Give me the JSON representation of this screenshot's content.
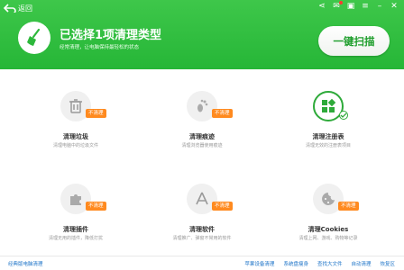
{
  "header": {
    "back_label": "返回",
    "title": "已选择1项清理类型",
    "subtitle": "经常清理，让电脑保持最轻松的状态",
    "scan_button": "一键扫描"
  },
  "items": [
    {
      "name": "清理垃圾",
      "desc": "清理电脑中的垃圾文件",
      "badge": "不清理",
      "icon": "trash-icon"
    },
    {
      "name": "清理痕迹",
      "desc": "清理浏览器使用痕迹",
      "badge": "不清理",
      "icon": "footprint-icon"
    },
    {
      "name": "清理注册表",
      "desc": "清理无效的注册表项目",
      "badge": "",
      "icon": "registry-icon"
    },
    {
      "name": "清理插件",
      "desc": "清理无用的插件，降低打扰",
      "badge": "不清理",
      "icon": "plugin-icon"
    },
    {
      "name": "清理软件",
      "desc": "清理推广、弹窗不常用的软件",
      "badge": "不清理",
      "icon": "software-icon"
    },
    {
      "name": "清理Cookies",
      "desc": "清理上网、游戏、购物等记录",
      "badge": "不清理",
      "icon": "cookie-icon"
    }
  ],
  "footer": {
    "left_link": "经典版电脑清理",
    "links": [
      "苹果设备清理",
      "系统盘瘦身",
      "查找大文件",
      "自动清理",
      "恢复区"
    ]
  },
  "colors": {
    "header_green": "#2db83b",
    "accent_green": "#2eaa3a",
    "badge_orange": "#ff8a1f",
    "link_blue": "#1e74c8"
  }
}
